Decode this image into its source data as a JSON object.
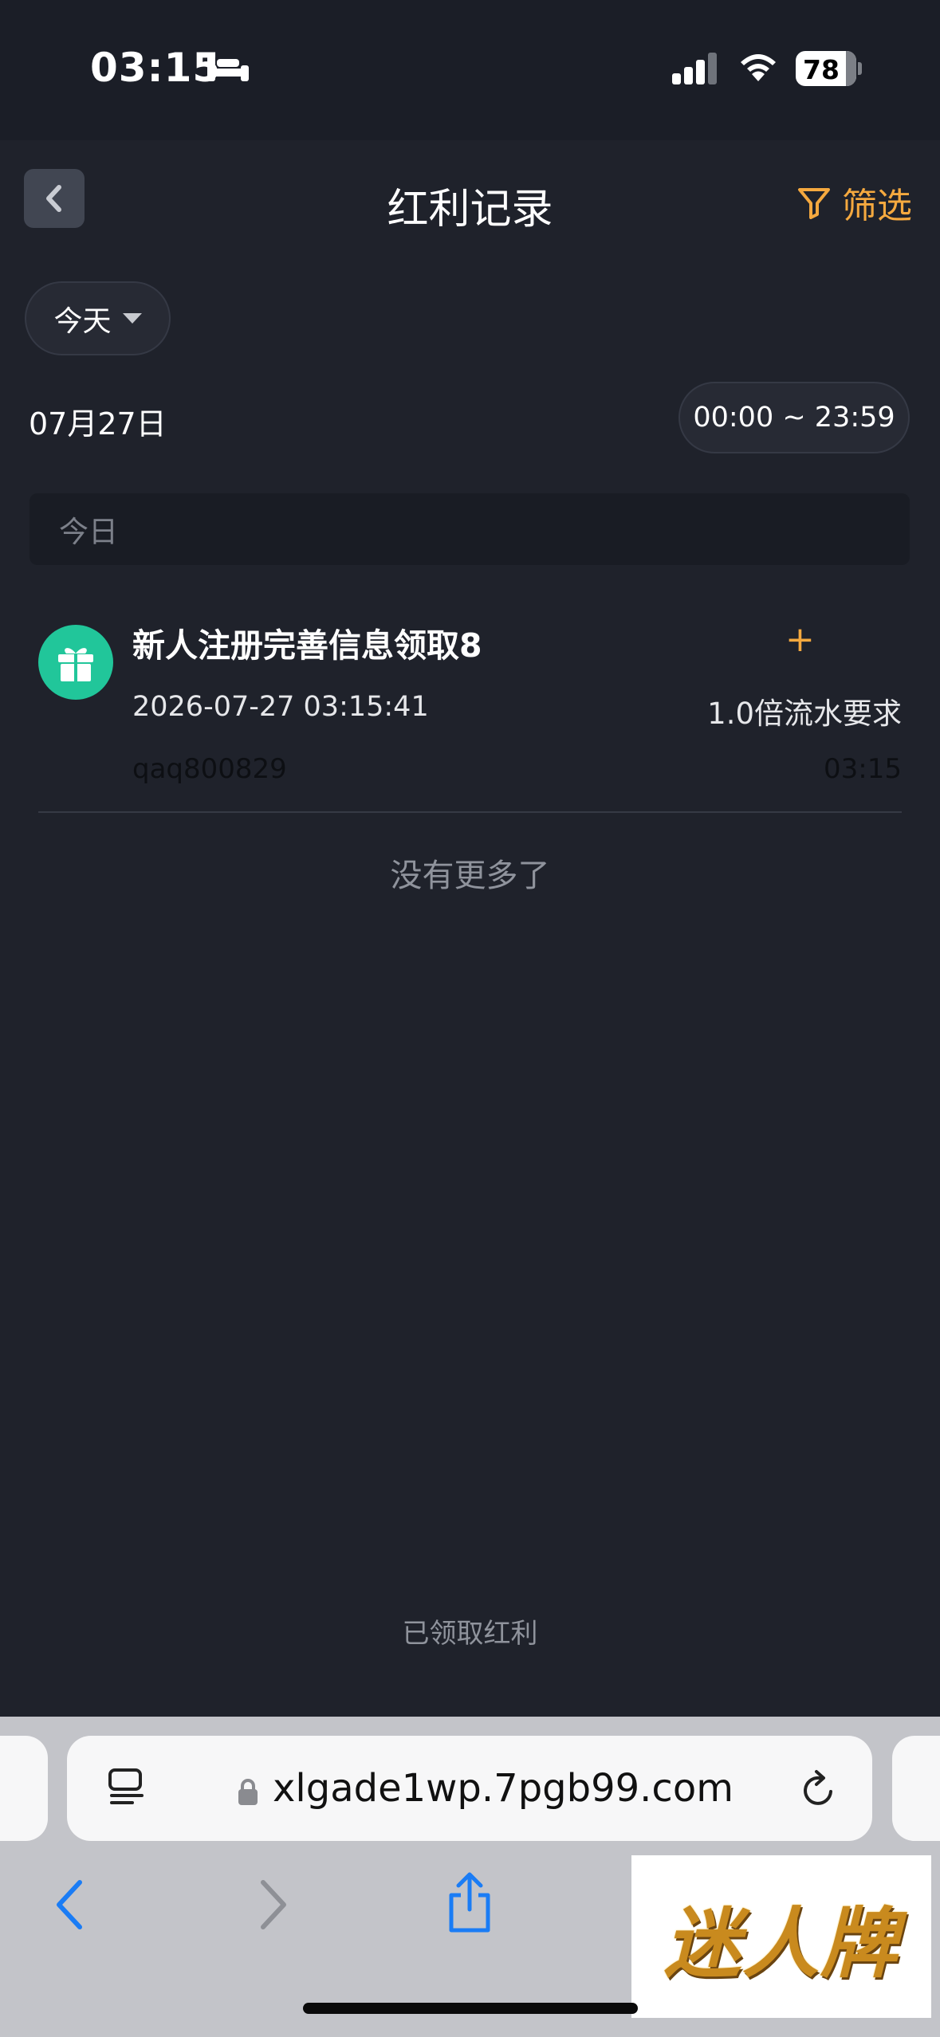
{
  "status_bar": {
    "time": "03:15",
    "battery": "78",
    "icons": [
      "bed-icon",
      "signal-icon",
      "wifi-icon",
      "battery-icon"
    ]
  },
  "header": {
    "back_icon": "chevron-left-icon",
    "title": "红利记录",
    "filter_label": "筛选",
    "filter_icon": "funnel-icon"
  },
  "date_filter": {
    "selected": "今天",
    "date": "07月27日",
    "time_range": "00:00 ~ 23:59"
  },
  "section": {
    "label": "今日"
  },
  "records": [
    {
      "icon": "gift-icon",
      "title": "新人注册完善信息领取8",
      "amount_sign": "+",
      "datetime": "2026-07-27 03:15:41",
      "requirement": "1.0倍流水要求",
      "username": "qaq800829",
      "time": "03:15"
    }
  ],
  "list_end": "没有更多了",
  "footer_label": "已领取红利",
  "browser": {
    "url": "xlgade1wp.7pgb99.com",
    "icons": [
      "reader-icon",
      "lock-icon",
      "reload-icon",
      "back-arrow-icon",
      "forward-arrow-icon",
      "share-icon"
    ]
  },
  "watermark": "迷人牌",
  "colors": {
    "background": "#1f222b",
    "accent": "#f5a93f",
    "gift": "#21c69a",
    "browser_blue": "#1a7cf5"
  }
}
